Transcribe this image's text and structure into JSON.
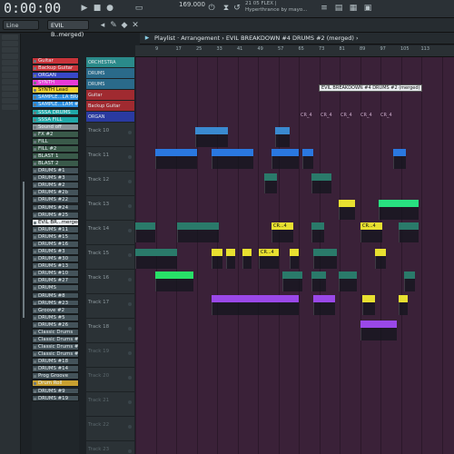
{
  "transport": {
    "time": "0:00:00",
    "tempo": "169.000",
    "hint_line1": "21 05 FLEX |",
    "hint_line2": "Hyperthrance by mayo..."
  },
  "toolbar": {
    "snap": "Line",
    "pattern": "EVIL B..merged)"
  },
  "playlist": {
    "title": "Playlist · Arrangement › EVIL BREAKDOWN #4 DRUMS #2 (merged) ›"
  },
  "ruler": {
    "bars": [
      "9",
      "17",
      "25",
      "33",
      "41",
      "49",
      "57",
      "65",
      "73",
      "81",
      "89",
      "97",
      "105",
      "113"
    ]
  },
  "channels": [
    {
      "name": "Guitar",
      "color": "#c8343a"
    },
    {
      "name": "Backup Guitar",
      "color": "#c8343a"
    },
    {
      "name": "ORGAN",
      "color": "#3848c8"
    },
    {
      "name": "SYNTH",
      "color": "#e83ad8"
    },
    {
      "name": "SYNTH Lead",
      "color": "#f0d030"
    },
    {
      "name": "SAMPLE...LA BRAMS",
      "color": "#2d8fe0"
    },
    {
      "name": "SAMPLE...LAM #2",
      "color": "#2d8fe0"
    },
    {
      "name": "SSSA DRUMS",
      "color": "#20a8a8"
    },
    {
      "name": "SSSA FILL",
      "color": "#20a8a8"
    },
    {
      "name": "Sound off",
      "color": "#8a9499"
    },
    {
      "name": "FX #2",
      "color": "#3a5a4a"
    },
    {
      "name": "FILL",
      "color": "#3a5a4a"
    },
    {
      "name": "FILL #2",
      "color": "#3a5a4a"
    },
    {
      "name": "BLAST 1",
      "color": "#3a5a4a"
    },
    {
      "name": "BLAST 2",
      "color": "#3a5a4a"
    },
    {
      "name": "DRUMS #1",
      "color": "#44535a"
    },
    {
      "name": "DRUMS #3",
      "color": "#44535a"
    },
    {
      "name": "DRUMS #2",
      "color": "#44535a"
    },
    {
      "name": "DRUMS #2b",
      "color": "#44535a"
    },
    {
      "name": "DRUMS #22",
      "color": "#44535a"
    },
    {
      "name": "DRUMS #24",
      "color": "#44535a"
    },
    {
      "name": "DRUMS #25",
      "color": "#44535a"
    },
    {
      "name": "EVIL BR...merged",
      "color": "#e8ecef"
    },
    {
      "name": "DRUMS #11",
      "color": "#44535a"
    },
    {
      "name": "DRUMS #15",
      "color": "#44535a"
    },
    {
      "name": "DRUMS #16",
      "color": "#44535a"
    },
    {
      "name": "DRUMS #3",
      "color": "#44535a"
    },
    {
      "name": "DRUMS #30",
      "color": "#44535a"
    },
    {
      "name": "DRUMS #13",
      "color": "#44535a"
    },
    {
      "name": "DRUMS #10",
      "color": "#44535a"
    },
    {
      "name": "DRUMS #27",
      "color": "#44535a"
    },
    {
      "name": "DRUMS",
      "color": "#44535a"
    },
    {
      "name": "DRUMS #8",
      "color": "#44535a"
    },
    {
      "name": "DRUMS #23",
      "color": "#44535a"
    },
    {
      "name": "Groove #2",
      "color": "#44535a"
    },
    {
      "name": "DRUMS #5",
      "color": "#44535a"
    },
    {
      "name": "DRUMS #26",
      "color": "#44535a"
    },
    {
      "name": "Classic Drums",
      "color": "#44535a"
    },
    {
      "name": "Classic Drums #4",
      "color": "#44535a"
    },
    {
      "name": "Classic Drums #2",
      "color": "#44535a"
    },
    {
      "name": "Classic Drums #3",
      "color": "#44535a"
    },
    {
      "name": "DRUMS #18",
      "color": "#44535a"
    },
    {
      "name": "DRUMS #14",
      "color": "#44535a"
    },
    {
      "name": "Prog Groove",
      "color": "#44535a"
    },
    {
      "name": "Drum Roll",
      "color": "#c8a030"
    },
    {
      "name": "DRUMS #9",
      "color": "#44535a"
    },
    {
      "name": "DRUMS #19",
      "color": "#44535a"
    }
  ],
  "tracks": [
    "Track 10",
    "Track 11",
    "Track 12",
    "Track 13",
    "Track 14",
    "Track 15",
    "Track 16",
    "Track 17",
    "Track 18",
    "Track 19",
    "Track 20",
    "Track 21",
    "Track 22",
    "Track 23"
  ],
  "top_tracks": [
    "ORCHESTRA",
    "DRUMS",
    "DRUMS",
    "Guitar",
    "Backup Guitar",
    "ORGAN"
  ],
  "pattern_label": "EVIL BREAKDOWN #4 DRUMS #2 (merged)",
  "marker_labels": [
    "CR_4",
    "CR_4",
    "CR_4",
    "CR_4",
    "CR_4"
  ],
  "clip_labels": {
    "cr1": "CR...4",
    "cr2": "CR...4",
    "cr3": "CR...4"
  }
}
